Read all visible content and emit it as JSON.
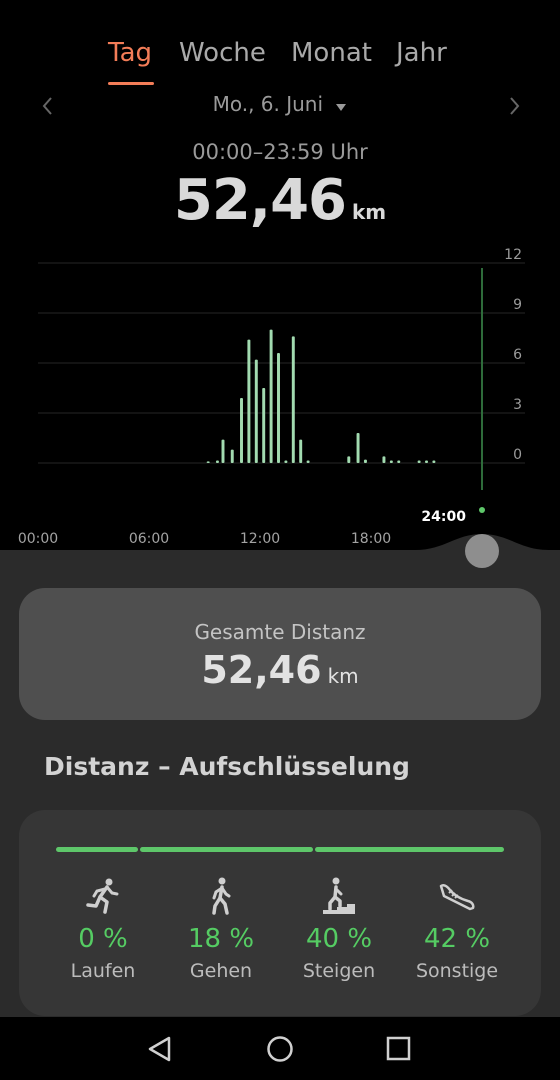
{
  "tabs": [
    {
      "label": "Tag",
      "active": true
    },
    {
      "label": "Woche",
      "active": false
    },
    {
      "label": "Monat",
      "active": false
    },
    {
      "label": "Jahr",
      "active": false
    }
  ],
  "date": {
    "label": "Mo., 6. Juni"
  },
  "time_range": "00:00–23:59 Uhr",
  "summary": {
    "value": "52,46",
    "unit": "km"
  },
  "chart_data": {
    "type": "bar",
    "x_tick_labels": [
      "00:00",
      "06:00",
      "12:00",
      "18:00"
    ],
    "y_tick_labels": [
      "12",
      "9",
      "6",
      "3",
      "0"
    ],
    "ylim": [
      0,
      12
    ],
    "xlim": [
      0,
      24
    ],
    "grid": true,
    "current_marker_label": "24:00",
    "bar_width_hours": 0.16,
    "bar_color": "#a2dbb0",
    "values": [
      {
        "x": 9.2,
        "y": 0.1
      },
      {
        "x": 9.7,
        "y": 0.15
      },
      {
        "x": 10.0,
        "y": 1.4
      },
      {
        "x": 10.5,
        "y": 0.8
      },
      {
        "x": 11.0,
        "y": 3.9
      },
      {
        "x": 11.4,
        "y": 7.4
      },
      {
        "x": 11.8,
        "y": 6.2
      },
      {
        "x": 12.2,
        "y": 4.5
      },
      {
        "x": 12.6,
        "y": 8.0
      },
      {
        "x": 13.0,
        "y": 6.6
      },
      {
        "x": 13.4,
        "y": 0.15
      },
      {
        "x": 13.8,
        "y": 7.6
      },
      {
        "x": 14.2,
        "y": 1.4
      },
      {
        "x": 14.6,
        "y": 0.15
      },
      {
        "x": 16.8,
        "y": 0.4
      },
      {
        "x": 17.3,
        "y": 1.8
      },
      {
        "x": 17.7,
        "y": 0.2
      },
      {
        "x": 18.7,
        "y": 0.4
      },
      {
        "x": 19.1,
        "y": 0.15
      },
      {
        "x": 19.5,
        "y": 0.15
      },
      {
        "x": 20.6,
        "y": 0.15
      },
      {
        "x": 21.0,
        "y": 0.15
      },
      {
        "x": 21.4,
        "y": 0.15
      }
    ]
  },
  "total": {
    "label": "Gesamte Distanz",
    "value": "52,46",
    "unit": "km"
  },
  "breakdown": {
    "title": "Distanz – Aufschlüsselung",
    "bar_color": "#5ec76a",
    "items": [
      {
        "label": "Laufen",
        "percent": "0 %",
        "icon": "running-icon"
      },
      {
        "label": "Gehen",
        "percent": "18 %",
        "icon": "walking-icon"
      },
      {
        "label": "Steigen",
        "percent": "40 %",
        "icon": "stairs-climbing-icon"
      },
      {
        "label": "Sonstige",
        "percent": "42 %",
        "icon": "shoe-icon"
      }
    ]
  },
  "system_nav": [
    "back-icon",
    "home-icon",
    "recents-icon"
  ]
}
